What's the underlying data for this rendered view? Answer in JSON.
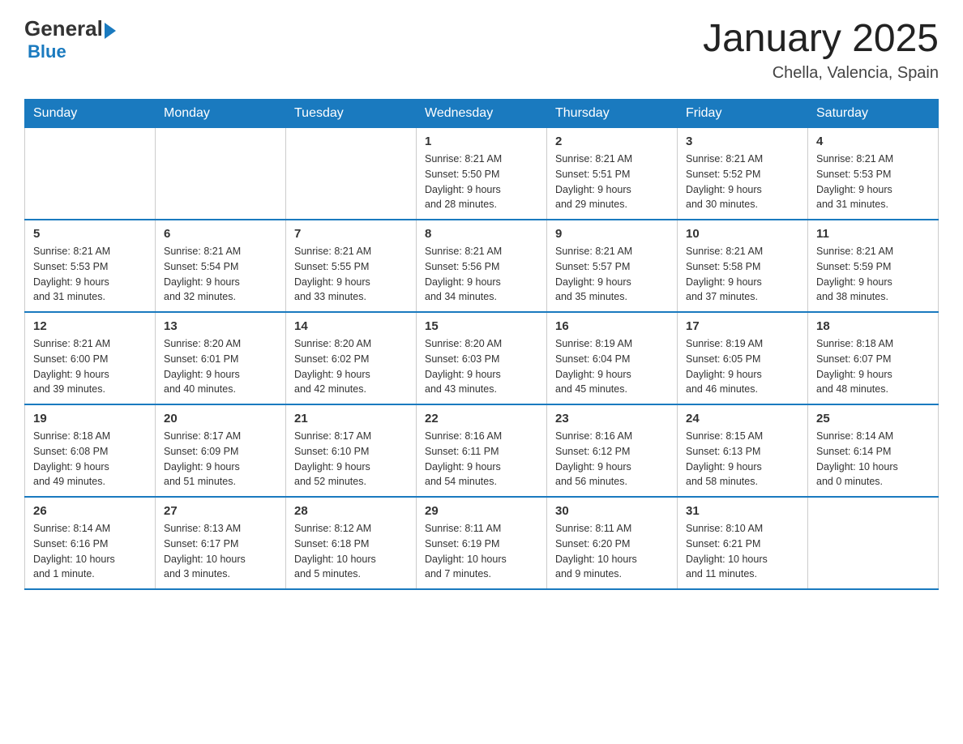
{
  "header": {
    "logo_general": "General",
    "logo_blue": "Blue",
    "main_title": "January 2025",
    "subtitle": "Chella, Valencia, Spain"
  },
  "calendar": {
    "days_of_week": [
      "Sunday",
      "Monday",
      "Tuesday",
      "Wednesday",
      "Thursday",
      "Friday",
      "Saturday"
    ],
    "weeks": [
      [
        {
          "day": "",
          "info": ""
        },
        {
          "day": "",
          "info": ""
        },
        {
          "day": "",
          "info": ""
        },
        {
          "day": "1",
          "info": "Sunrise: 8:21 AM\nSunset: 5:50 PM\nDaylight: 9 hours\nand 28 minutes."
        },
        {
          "day": "2",
          "info": "Sunrise: 8:21 AM\nSunset: 5:51 PM\nDaylight: 9 hours\nand 29 minutes."
        },
        {
          "day": "3",
          "info": "Sunrise: 8:21 AM\nSunset: 5:52 PM\nDaylight: 9 hours\nand 30 minutes."
        },
        {
          "day": "4",
          "info": "Sunrise: 8:21 AM\nSunset: 5:53 PM\nDaylight: 9 hours\nand 31 minutes."
        }
      ],
      [
        {
          "day": "5",
          "info": "Sunrise: 8:21 AM\nSunset: 5:53 PM\nDaylight: 9 hours\nand 31 minutes."
        },
        {
          "day": "6",
          "info": "Sunrise: 8:21 AM\nSunset: 5:54 PM\nDaylight: 9 hours\nand 32 minutes."
        },
        {
          "day": "7",
          "info": "Sunrise: 8:21 AM\nSunset: 5:55 PM\nDaylight: 9 hours\nand 33 minutes."
        },
        {
          "day": "8",
          "info": "Sunrise: 8:21 AM\nSunset: 5:56 PM\nDaylight: 9 hours\nand 34 minutes."
        },
        {
          "day": "9",
          "info": "Sunrise: 8:21 AM\nSunset: 5:57 PM\nDaylight: 9 hours\nand 35 minutes."
        },
        {
          "day": "10",
          "info": "Sunrise: 8:21 AM\nSunset: 5:58 PM\nDaylight: 9 hours\nand 37 minutes."
        },
        {
          "day": "11",
          "info": "Sunrise: 8:21 AM\nSunset: 5:59 PM\nDaylight: 9 hours\nand 38 minutes."
        }
      ],
      [
        {
          "day": "12",
          "info": "Sunrise: 8:21 AM\nSunset: 6:00 PM\nDaylight: 9 hours\nand 39 minutes."
        },
        {
          "day": "13",
          "info": "Sunrise: 8:20 AM\nSunset: 6:01 PM\nDaylight: 9 hours\nand 40 minutes."
        },
        {
          "day": "14",
          "info": "Sunrise: 8:20 AM\nSunset: 6:02 PM\nDaylight: 9 hours\nand 42 minutes."
        },
        {
          "day": "15",
          "info": "Sunrise: 8:20 AM\nSunset: 6:03 PM\nDaylight: 9 hours\nand 43 minutes."
        },
        {
          "day": "16",
          "info": "Sunrise: 8:19 AM\nSunset: 6:04 PM\nDaylight: 9 hours\nand 45 minutes."
        },
        {
          "day": "17",
          "info": "Sunrise: 8:19 AM\nSunset: 6:05 PM\nDaylight: 9 hours\nand 46 minutes."
        },
        {
          "day": "18",
          "info": "Sunrise: 8:18 AM\nSunset: 6:07 PM\nDaylight: 9 hours\nand 48 minutes."
        }
      ],
      [
        {
          "day": "19",
          "info": "Sunrise: 8:18 AM\nSunset: 6:08 PM\nDaylight: 9 hours\nand 49 minutes."
        },
        {
          "day": "20",
          "info": "Sunrise: 8:17 AM\nSunset: 6:09 PM\nDaylight: 9 hours\nand 51 minutes."
        },
        {
          "day": "21",
          "info": "Sunrise: 8:17 AM\nSunset: 6:10 PM\nDaylight: 9 hours\nand 52 minutes."
        },
        {
          "day": "22",
          "info": "Sunrise: 8:16 AM\nSunset: 6:11 PM\nDaylight: 9 hours\nand 54 minutes."
        },
        {
          "day": "23",
          "info": "Sunrise: 8:16 AM\nSunset: 6:12 PM\nDaylight: 9 hours\nand 56 minutes."
        },
        {
          "day": "24",
          "info": "Sunrise: 8:15 AM\nSunset: 6:13 PM\nDaylight: 9 hours\nand 58 minutes."
        },
        {
          "day": "25",
          "info": "Sunrise: 8:14 AM\nSunset: 6:14 PM\nDaylight: 10 hours\nand 0 minutes."
        }
      ],
      [
        {
          "day": "26",
          "info": "Sunrise: 8:14 AM\nSunset: 6:16 PM\nDaylight: 10 hours\nand 1 minute."
        },
        {
          "day": "27",
          "info": "Sunrise: 8:13 AM\nSunset: 6:17 PM\nDaylight: 10 hours\nand 3 minutes."
        },
        {
          "day": "28",
          "info": "Sunrise: 8:12 AM\nSunset: 6:18 PM\nDaylight: 10 hours\nand 5 minutes."
        },
        {
          "day": "29",
          "info": "Sunrise: 8:11 AM\nSunset: 6:19 PM\nDaylight: 10 hours\nand 7 minutes."
        },
        {
          "day": "30",
          "info": "Sunrise: 8:11 AM\nSunset: 6:20 PM\nDaylight: 10 hours\nand 9 minutes."
        },
        {
          "day": "31",
          "info": "Sunrise: 8:10 AM\nSunset: 6:21 PM\nDaylight: 10 hours\nand 11 minutes."
        },
        {
          "day": "",
          "info": ""
        }
      ]
    ]
  }
}
